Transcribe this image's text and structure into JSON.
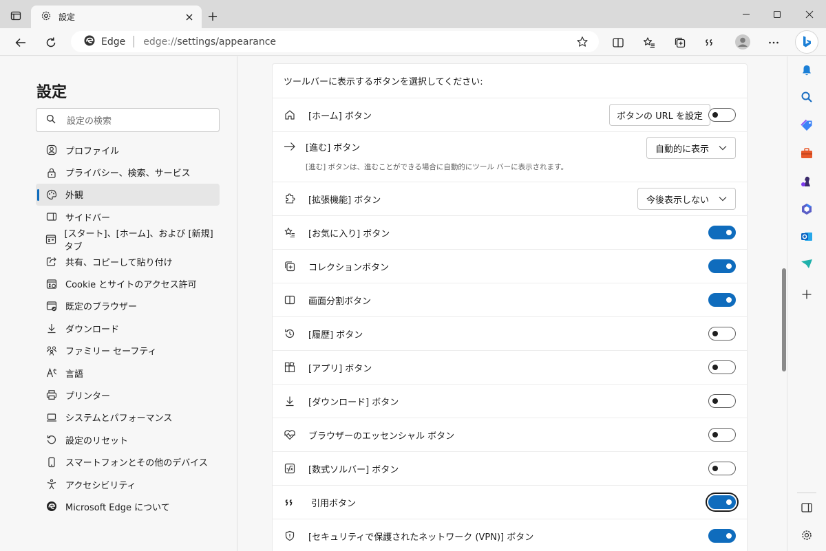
{
  "tab": {
    "title": "設定",
    "icon": "gear-icon"
  },
  "address": {
    "brand": "Edge",
    "url_scheme": "edge://",
    "url_path": "settings/appearance"
  },
  "sidebar_nav": {
    "title": "設定",
    "search_placeholder": "設定の検索",
    "items": [
      {
        "label": "プロファイル",
        "icon": "profile-icon",
        "active": false
      },
      {
        "label": "プライバシー、検索、サービス",
        "icon": "lock-icon",
        "active": false
      },
      {
        "label": "外観",
        "icon": "palette-icon",
        "active": true
      },
      {
        "label": "サイドバー",
        "icon": "sidebar-icon",
        "active": false
      },
      {
        "label": "[スタート]、[ホーム]、および [新規] タブ",
        "icon": "start-tab-icon",
        "active": false
      },
      {
        "label": "共有、コピーして貼り付け",
        "icon": "share-icon",
        "active": false
      },
      {
        "label": "Cookie とサイトのアクセス許可",
        "icon": "cookie-permissions-icon",
        "active": false
      },
      {
        "label": "既定のブラウザー",
        "icon": "default-browser-icon",
        "active": false
      },
      {
        "label": "ダウンロード",
        "icon": "download-icon",
        "active": false
      },
      {
        "label": "ファミリー セーフティ",
        "icon": "family-icon",
        "active": false
      },
      {
        "label": "言語",
        "icon": "language-icon",
        "active": false
      },
      {
        "label": "プリンター",
        "icon": "printer-icon",
        "active": false
      },
      {
        "label": "システムとパフォーマンス",
        "icon": "laptop-icon",
        "active": false
      },
      {
        "label": "設定のリセット",
        "icon": "reset-icon",
        "active": false
      },
      {
        "label": "スマートフォンとその他のデバイス",
        "icon": "phone-icon",
        "active": false
      },
      {
        "label": "アクセシビリティ",
        "icon": "accessibility-icon",
        "active": false
      },
      {
        "label": "Microsoft Edge について",
        "icon": "edge-logo-icon",
        "active": false
      }
    ]
  },
  "main": {
    "header": "ツールバーに表示するボタンを選択してください:",
    "rows": {
      "home": {
        "label": "[ホーム] ボタン",
        "button": "ボタンの URL を設定",
        "on": false
      },
      "forward": {
        "label": "[進む] ボタン",
        "desc": "[進む] ボタンは、進むことができる場合に自動的にツール バーに表示されます。",
        "dropdown": "自動的に表示"
      },
      "extensions": {
        "label": "[拡張機能] ボタン",
        "dropdown": "今後表示しない"
      },
      "favorites": {
        "label": "[お気に入り] ボタン",
        "on": true
      },
      "collections": {
        "label": "コレクションボタン",
        "on": true
      },
      "split": {
        "label": "画面分割ボタン",
        "on": true
      },
      "history": {
        "label": "[履歴] ボタン",
        "on": false
      },
      "apps": {
        "label": "[アプリ] ボタン",
        "on": false
      },
      "downloads": {
        "label": "[ダウンロード] ボタン",
        "on": false
      },
      "essentials": {
        "label": "ブラウザーのエッセンシャル ボタン",
        "on": false
      },
      "math": {
        "label": "[数式ソルバー] ボタン",
        "on": false
      },
      "citation": {
        "label": "引用ボタン",
        "on": true
      },
      "vpn": {
        "label": "[セキュリティで保護されたネットワーク (VPN)] ボタン",
        "on": true
      }
    }
  },
  "colors": {
    "accent": "#0f6cbd",
    "page_bg": "#f7f7f7",
    "card_bg": "#ffffff"
  }
}
